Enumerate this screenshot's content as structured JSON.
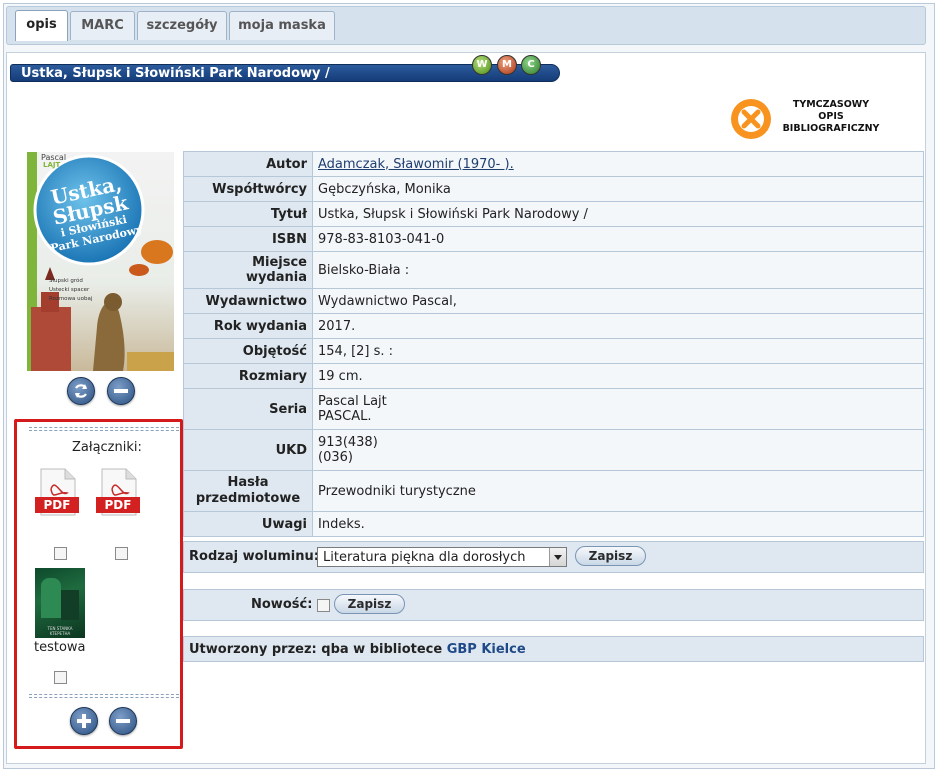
{
  "tabs": [
    {
      "label": "opis",
      "active": true
    },
    {
      "label": "MARC"
    },
    {
      "label": "szczegóły"
    },
    {
      "label": "moja maska"
    }
  ],
  "record_title": "Ustka, Słupsk i Słowiński Park Narodowy /",
  "badges": [
    "W",
    "M",
    "C"
  ],
  "temp_notice": [
    "TYMCZASOWY",
    "OPIS",
    "BIBLIOGRAFICZNY"
  ],
  "cover": {
    "publisher": "Pascal",
    "series_mark": "LAJT",
    "title_lines": [
      "Ustka,",
      "Słupsk",
      "i Słowiński",
      "Park Narodowy"
    ],
    "subtitle_lines": [
      "Słupski gród",
      "Ustecki spacer",
      "Rozmowa uobaj"
    ]
  },
  "attachments": {
    "label": "Załączniki:",
    "pdf_text": "PDF",
    "image_caption": "testowa",
    "image_text": "TEN STANKA KTEPETHA"
  },
  "fields": [
    {
      "key": "Autor",
      "value": "Adamczak, Sławomir (1970- ).",
      "link": true
    },
    {
      "key": "Współtwórcy",
      "value": "Gębczyńska, Monika"
    },
    {
      "key": "Tytuł",
      "value": "Ustka, Słupsk i Słowiński Park Narodowy /"
    },
    {
      "key": "ISBN",
      "value": "978-83-8103-041-0"
    },
    {
      "key": "Miejsce wydania",
      "value": "Bielsko-Biała :"
    },
    {
      "key": "Wydawnictwo",
      "value": "Wydawnictwo Pascal,"
    },
    {
      "key": "Rok wydania",
      "value": "2017."
    },
    {
      "key": "Objętość",
      "value": "154, [2] s. :"
    },
    {
      "key": "Rozmiary",
      "value": "19 cm."
    },
    {
      "key": "Seria",
      "lines": [
        "Pascal Lajt",
        "PASCAL."
      ]
    },
    {
      "key": "UKD",
      "lines": [
        "913(438)",
        "(036)"
      ]
    },
    {
      "key_lines": [
        "Hasła",
        "przedmiotowe"
      ],
      "value": "Przewodniki turystyczne"
    },
    {
      "key": "Uwagi",
      "value": "Indeks."
    }
  ],
  "volume": {
    "label": "Rodzaj woluminu:",
    "selected": "Literatura piękna dla dorosłych",
    "save": "Zapisz"
  },
  "novelty": {
    "label": "Nowość:",
    "save": "Zapisz"
  },
  "created": {
    "prefix": "Utworzony przez: qba w bibliotece ",
    "library": "GBP Kielce"
  },
  "colors": {
    "accent": "#1f4a87",
    "frame": "#d41a1a",
    "row_key_bg": "#dfe8f0",
    "temp_icon": "#f7931e"
  }
}
